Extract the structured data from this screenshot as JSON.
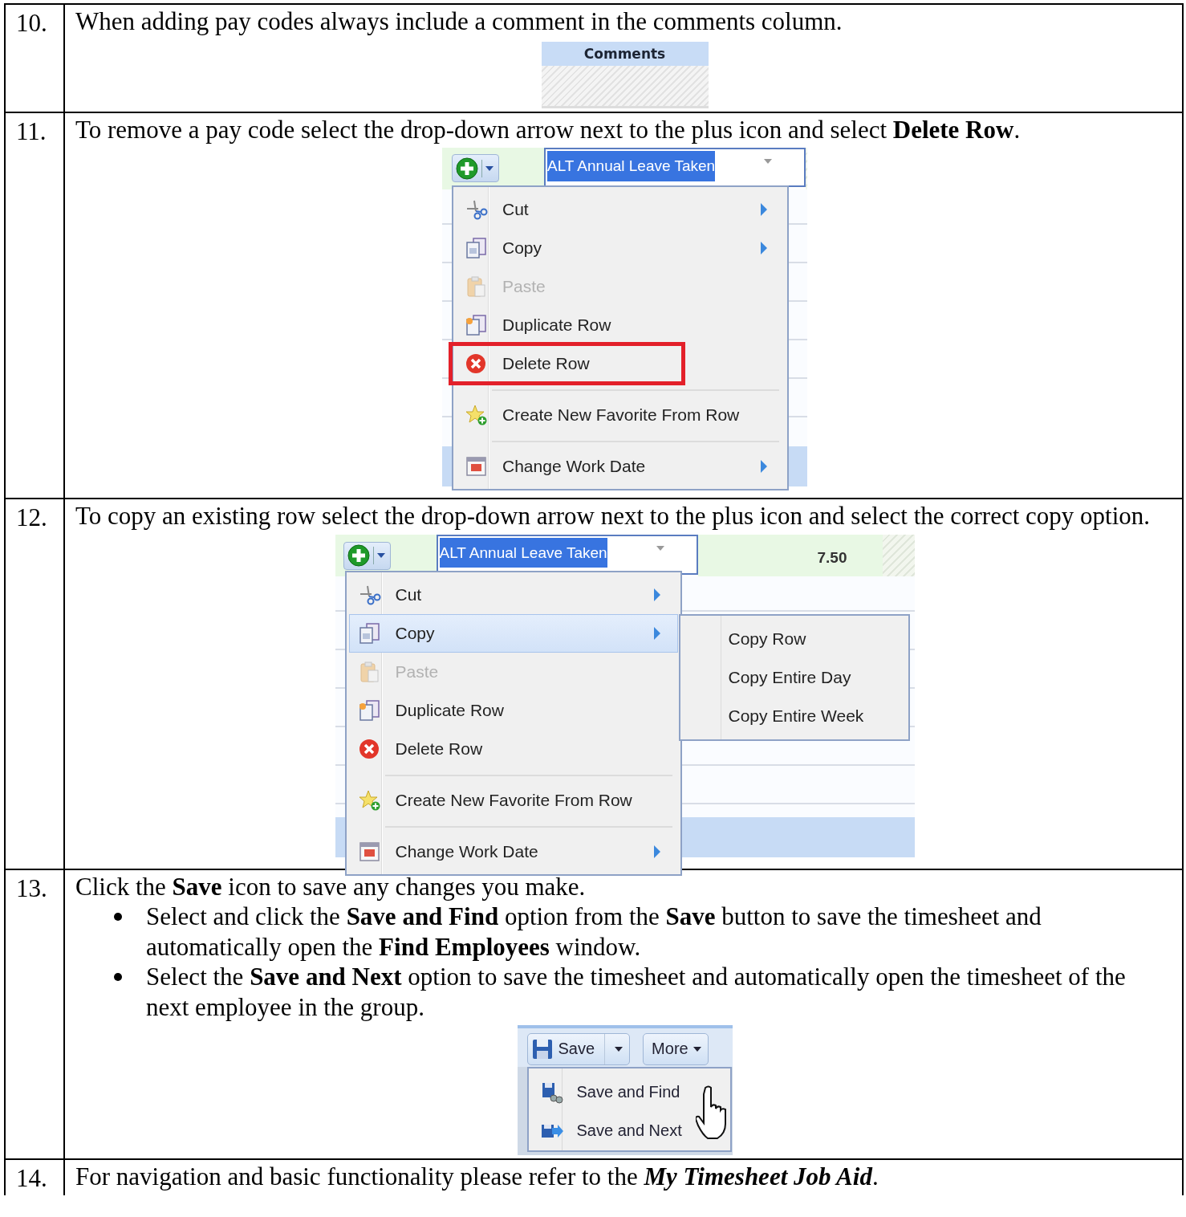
{
  "steps": [
    {
      "number": "10.",
      "text": "When adding pay codes always include a comment in the comments column.",
      "figure": {
        "kind": "column",
        "heading": "Comments"
      }
    },
    {
      "number": "11.",
      "text": "To remove a pay code select the drop-down arrow next to the plus icon and select **Delete Row**.",
      "figure": {
        "kind": "menu",
        "field_value": "ALT Annual Leave Taken",
        "menu": [
          {
            "label": "Cut",
            "kind": "cut",
            "disabled": false,
            "selected": false,
            "callout": false,
            "submenu": true,
            "separator": false
          },
          {
            "label": "Copy",
            "kind": "copy",
            "disabled": false,
            "selected": false,
            "callout": false,
            "submenu": true,
            "separator": false
          },
          {
            "label": "Paste",
            "kind": "paste",
            "disabled": true,
            "selected": false,
            "callout": false,
            "submenu": false,
            "separator": false
          },
          {
            "label": "Duplicate Row",
            "kind": "duplicate",
            "disabled": false,
            "selected": false,
            "callout": false,
            "submenu": false,
            "separator": false
          },
          {
            "label": "Delete Row",
            "kind": "delete",
            "disabled": false,
            "selected": false,
            "callout": true,
            "submenu": false,
            "separator": false
          },
          {
            "label": "Create New Favorite From Row",
            "kind": "favorite",
            "disabled": false,
            "selected": false,
            "callout": false,
            "submenu": false,
            "separator": true
          },
          {
            "label": "Change Work Date",
            "kind": "date",
            "disabled": false,
            "selected": false,
            "callout": false,
            "submenu": true,
            "separator": true
          }
        ]
      }
    },
    {
      "number": "12.",
      "text": "To copy an existing row select the drop-down arrow next to the plus icon and select the correct copy option.",
      "figure": {
        "kind": "menu",
        "field_value": "ALT Annual Leave Taken",
        "hours": "7.50",
        "menu": [
          {
            "label": "Cut",
            "kind": "cut",
            "disabled": false,
            "selected": false,
            "callout": false,
            "submenu": true,
            "separator": false
          },
          {
            "label": "Copy",
            "kind": "copy",
            "disabled": false,
            "selected": true,
            "callout": false,
            "submenu": true,
            "separator": false
          },
          {
            "label": "Paste",
            "kind": "paste",
            "disabled": true,
            "selected": false,
            "callout": false,
            "submenu": false,
            "separator": false
          },
          {
            "label": "Duplicate Row",
            "kind": "duplicate",
            "disabled": false,
            "selected": false,
            "callout": false,
            "submenu": false,
            "separator": false
          },
          {
            "label": "Delete Row",
            "kind": "delete",
            "disabled": false,
            "selected": false,
            "callout": false,
            "submenu": false,
            "separator": false
          },
          {
            "label": "Create New Favorite From Row",
            "kind": "favorite",
            "disabled": false,
            "selected": false,
            "callout": false,
            "submenu": false,
            "separator": true
          },
          {
            "label": "Change Work Date",
            "kind": "date",
            "disabled": false,
            "selected": false,
            "callout": false,
            "submenu": true,
            "separator": true
          }
        ],
        "submenu": [
          "Copy Row",
          "Copy Entire Day",
          "Copy Entire Week"
        ]
      }
    },
    {
      "number": "13.",
      "text": "Click the **Save** icon to save any changes you make.",
      "bullets": [
        "Select and click the **Save and Find** option from the **Save** button to save the timesheet and automatically open the **Find Employees** window.",
        "Select the **Save and Next** option to save the timesheet and automatically open the timesheet of the next employee in the group."
      ],
      "figure": {
        "kind": "save",
        "buttons": [
          "Save",
          "More"
        ],
        "menu": [
          {
            "label": "Save and Find",
            "kind": "find"
          },
          {
            "label": "Save and Next",
            "kind": "next"
          }
        ]
      }
    },
    {
      "number": "14.",
      "text": "For navigation and basic functionality please refer to the *My Timesheet Job Aid*."
    }
  ]
}
